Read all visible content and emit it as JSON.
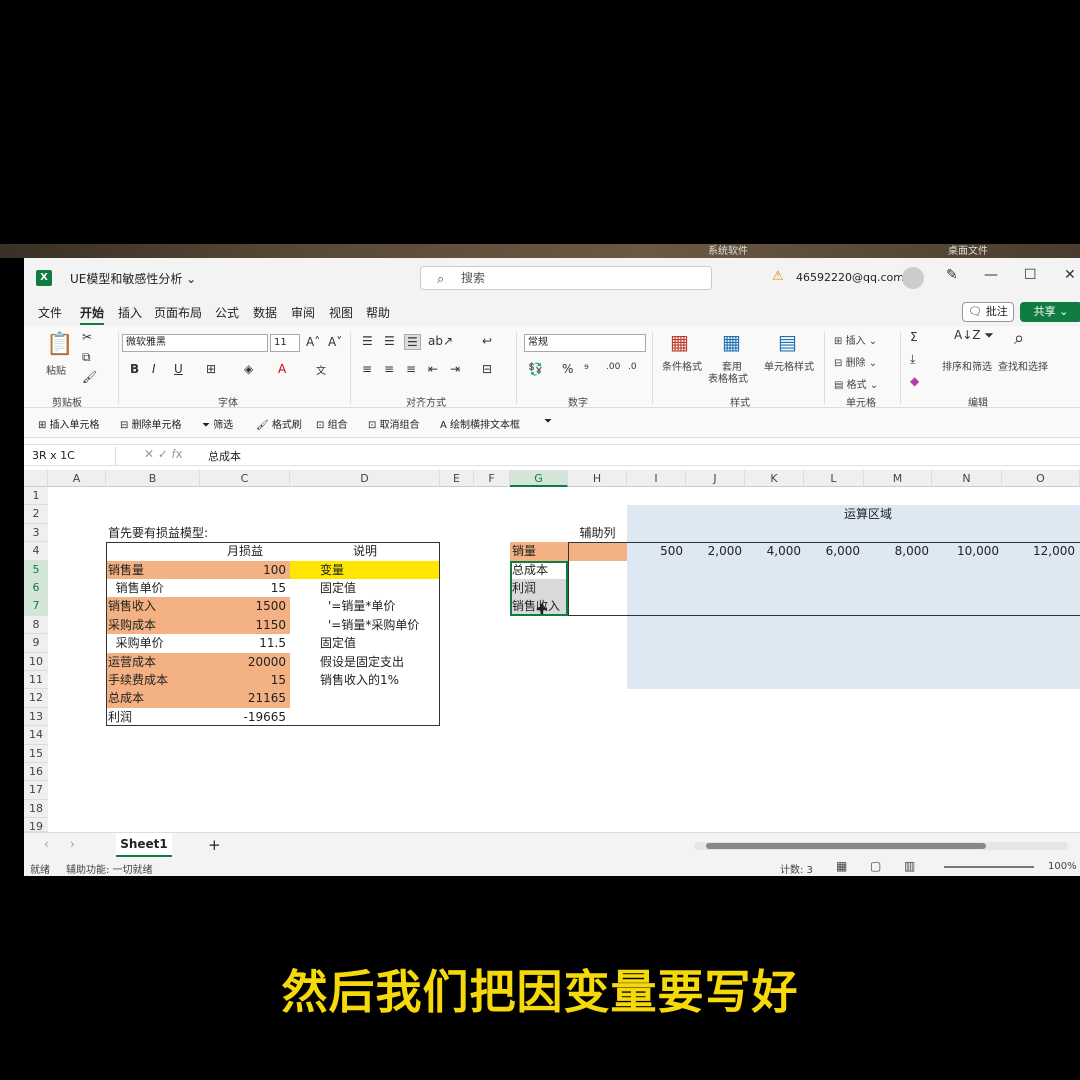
{
  "desktop": {
    "label1": "系统软件",
    "label2": "桌面文件"
  },
  "window": {
    "title": "UE模型和敏感性分析 ⌄",
    "search_placeholder": "搜索",
    "account": "46592220@qq.com"
  },
  "menu": {
    "items": [
      "文件",
      "开始",
      "插入",
      "页面布局",
      "公式",
      "数据",
      "审阅",
      "视图",
      "帮助"
    ],
    "active": "开始",
    "comment": "批注",
    "share": "共享"
  },
  "ribbon": {
    "clipboard": {
      "paste": "粘贴",
      "group": "剪贴板"
    },
    "font": {
      "name": "微软雅黑",
      "size": "11",
      "bold": "B",
      "italic": "I",
      "underline": "U",
      "group": "字体"
    },
    "align": {
      "group": "对齐方式"
    },
    "number": {
      "format": "常规",
      "percent": "%",
      "group": "数字"
    },
    "styles": {
      "cond": "条件格式",
      "table1": "套用",
      "table2": "表格格式",
      "cell": "单元格样式",
      "group": "样式"
    },
    "cells": {
      "insert": "插入",
      "delete": "删除",
      "format": "格式",
      "group": "单元格"
    },
    "edit": {
      "sum": "Σ",
      "sort": "排序和筛选",
      "find": "查找和选择",
      "group": "编辑"
    }
  },
  "quick": [
    "插入单元格",
    "删除单元格",
    "筛选",
    "格式刷",
    "组合",
    "取消组合",
    "绘制横排文本框"
  ],
  "formula": {
    "namebox": "3R x 1C",
    "content": "总成本"
  },
  "columns": [
    "A",
    "B",
    "C",
    "D",
    "E",
    "F",
    "G",
    "H",
    "I",
    "J",
    "K",
    "L",
    "M",
    "N",
    "O"
  ],
  "rows": [
    "1",
    "2",
    "3",
    "4",
    "5",
    "6",
    "7",
    "8",
    "9",
    "10",
    "11",
    "12",
    "13",
    "14",
    "15",
    "16",
    "17",
    "18",
    "19"
  ],
  "model": {
    "heading": "首先要有损益模型:",
    "col_c": "月损益",
    "col_d": "说明",
    "lines": [
      {
        "label": "销售量",
        "value": "100",
        "note": "变量"
      },
      {
        "label": "  销售单价",
        "value": "15",
        "note": "固定值"
      },
      {
        "label": "销售收入",
        "value": "1500",
        "note": "'=销量*单价"
      },
      {
        "label": "采购成本",
        "value": "1150",
        "note": "'=销量*采购单价"
      },
      {
        "label": "  采购单价",
        "value": "11.5",
        "note": "固定值"
      },
      {
        "label": "运营成本",
        "value": "20000",
        "note": "假设是固定支出"
      },
      {
        "label": "手续费成本",
        "value": "15",
        "note": "销售收入的1%"
      },
      {
        "label": "总成本",
        "value": "21165",
        "note": ""
      },
      {
        "label": "利润",
        "value": "-19665",
        "note": ""
      }
    ]
  },
  "sensitivity": {
    "title": "运算区域",
    "helper": "辅助列",
    "labels": [
      "销量",
      "总成本",
      "利润",
      "销售收入"
    ],
    "values": [
      "500",
      "2,000",
      "4,000",
      "6,000",
      "8,000",
      "10,000",
      "12,000"
    ]
  },
  "tabs": {
    "sheet": "Sheet1",
    "add": "+"
  },
  "status": {
    "ready": "就绪",
    "access": "辅助功能: 一切就绪",
    "count": "计数: 3",
    "zoom": "100%"
  },
  "subtitle": "然后我们把因变量要写好",
  "colors": {
    "accent": "#107c41",
    "orange": "#f4b183",
    "yellow": "#ffe600",
    "blue": "#dde8f3",
    "gray": "#d9d9d9"
  }
}
